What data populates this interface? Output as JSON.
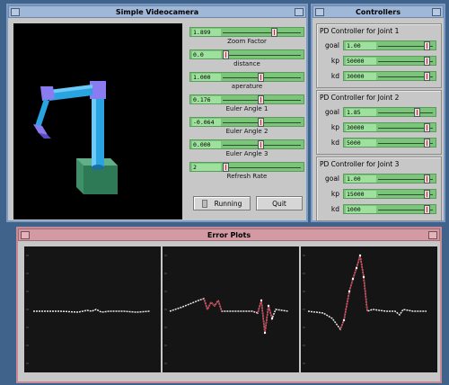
{
  "videocamera": {
    "title": "Simple Videocamera",
    "sliders": [
      {
        "value": "1.899",
        "label": "Zoom Factor",
        "level": 0.66
      },
      {
        "value": "0.0",
        "label": "distance",
        "level": 0.0
      },
      {
        "value": "1.000",
        "label": "aperature",
        "level": 0.47
      },
      {
        "value": "0.176",
        "label": "Euler Angle 1",
        "level": 0.47
      },
      {
        "value": "-0.064",
        "label": "Euler Angle 2",
        "level": 0.47
      },
      {
        "value": "0.000",
        "label": "Euler Angle 3",
        "level": 0.47
      },
      {
        "value": "2",
        "label": "Refresh Rate",
        "level": 0.0
      }
    ],
    "running_label": "Running",
    "quit_label": "Quit"
  },
  "controllers": {
    "title": "Controllers",
    "groups": [
      {
        "title": "PD Controller for Joint 1",
        "params": [
          {
            "label": "goal",
            "value": "1.00",
            "level": 0.91
          },
          {
            "label": "kp",
            "value": "50000",
            "level": 0.91
          },
          {
            "label": "kd",
            "value": "30000",
            "level": 0.91
          }
        ]
      },
      {
        "title": "PD Controller for Joint 2",
        "params": [
          {
            "label": "goal",
            "value": "1.85",
            "level": 0.72
          },
          {
            "label": "kp",
            "value": "30000",
            "level": 0.91
          },
          {
            "label": "kd",
            "value": "5000",
            "level": 0.91
          }
        ]
      },
      {
        "title": "PD Controller for Joint 3",
        "params": [
          {
            "label": "goal",
            "value": "1.00",
            "level": 0.91
          },
          {
            "label": "kp",
            "value": "15000",
            "level": 0.91
          },
          {
            "label": "kd",
            "value": "1000",
            "level": 0.91
          }
        ]
      }
    ]
  },
  "error_plots": {
    "title": "Error Plots"
  },
  "colors": {
    "desktop": "#3f638a",
    "slider_green": "#7ac57a",
    "arm_blue": "#2aa4e0",
    "arm_violet": "#8a7cf0",
    "base_green": "#3f8f68",
    "plot_trace": "#e8e8e8",
    "plot_fit": "#c8283c"
  }
}
